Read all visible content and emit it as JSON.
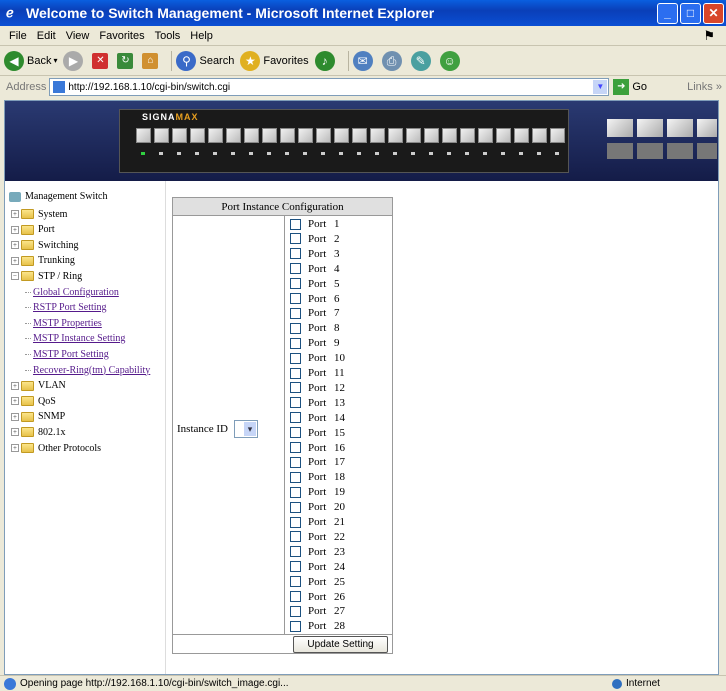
{
  "window": {
    "title": "Welcome to Switch Management - Microsoft Internet Explorer"
  },
  "menu": [
    "File",
    "Edit",
    "View",
    "Favorites",
    "Tools",
    "Help"
  ],
  "toolbar": {
    "back": "Back",
    "search": "Search",
    "favorites": "Favorites"
  },
  "address": {
    "label": "Address",
    "url": "http://192.168.1.10/cgi-bin/switch.cgi",
    "go": "Go",
    "links": "Links"
  },
  "banner": {
    "brand_a": "SIGNA",
    "brand_b": "MAX"
  },
  "tree": {
    "root": "Management Switch",
    "folders": [
      "System",
      "Port",
      "Switching",
      "Trunking",
      "STP / Ring",
      "VLAN",
      "QoS",
      "SNMP",
      "802.1x",
      "Other Protocols"
    ],
    "stp_children": [
      "Global Configuration",
      "RSTP Port Setting",
      "MSTP Properties",
      "MSTP Instance Setting",
      "MSTP Port Setting",
      "Recover-Ring(tm) Capability"
    ]
  },
  "config": {
    "header": "Port Instance Configuration",
    "instance_label": "Instance ID",
    "port_word": "Port",
    "ports": [
      "1",
      "2",
      "3",
      "4",
      "5",
      "6",
      "7",
      "8",
      "9",
      "10",
      "11",
      "12",
      "13",
      "14",
      "15",
      "16",
      "17",
      "18",
      "19",
      "20",
      "21",
      "22",
      "23",
      "24",
      "25",
      "26",
      "27",
      "28"
    ],
    "button": "Update Setting"
  },
  "status": {
    "text": "Opening page http://192.168.1.10/cgi-bin/switch_image.cgi...",
    "zone": "Internet"
  }
}
